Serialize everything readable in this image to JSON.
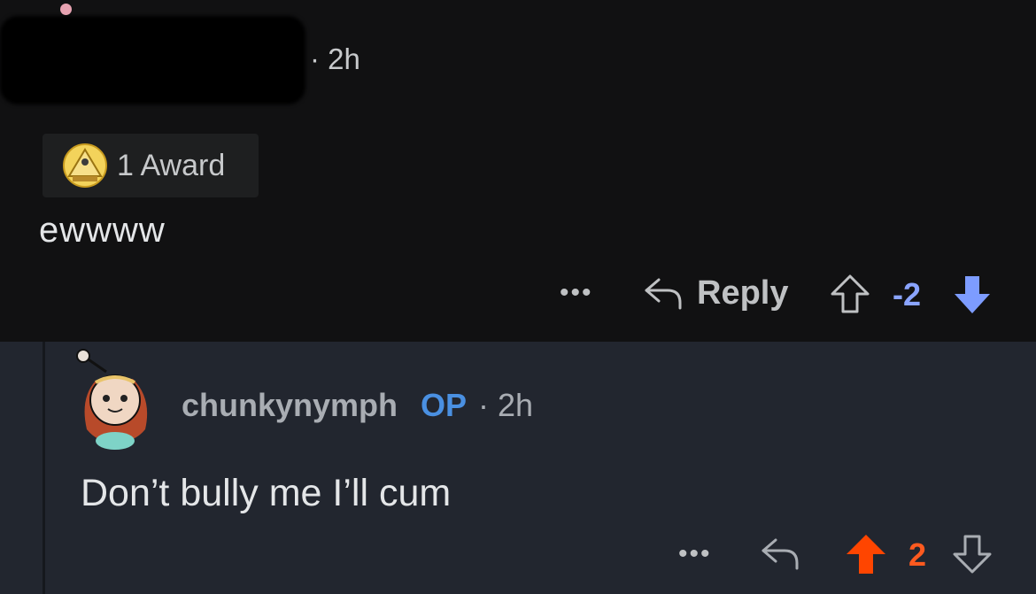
{
  "comment_1": {
    "time": "· 2h",
    "award_label": "1 Award",
    "body": "ewwww",
    "actions": {
      "more": "•••",
      "reply_label": "Reply",
      "score": "-2",
      "vote_state": "downvoted",
      "downvote_color": "#7d9cff"
    }
  },
  "comment_2": {
    "username": "chunkynymph",
    "op_badge": "OP",
    "time": "· 2h",
    "body": "Don’t bully me I’ll cum",
    "actions": {
      "more": "•••",
      "score": "2",
      "vote_state": "upvoted",
      "upvote_color": "#ff4500"
    }
  }
}
